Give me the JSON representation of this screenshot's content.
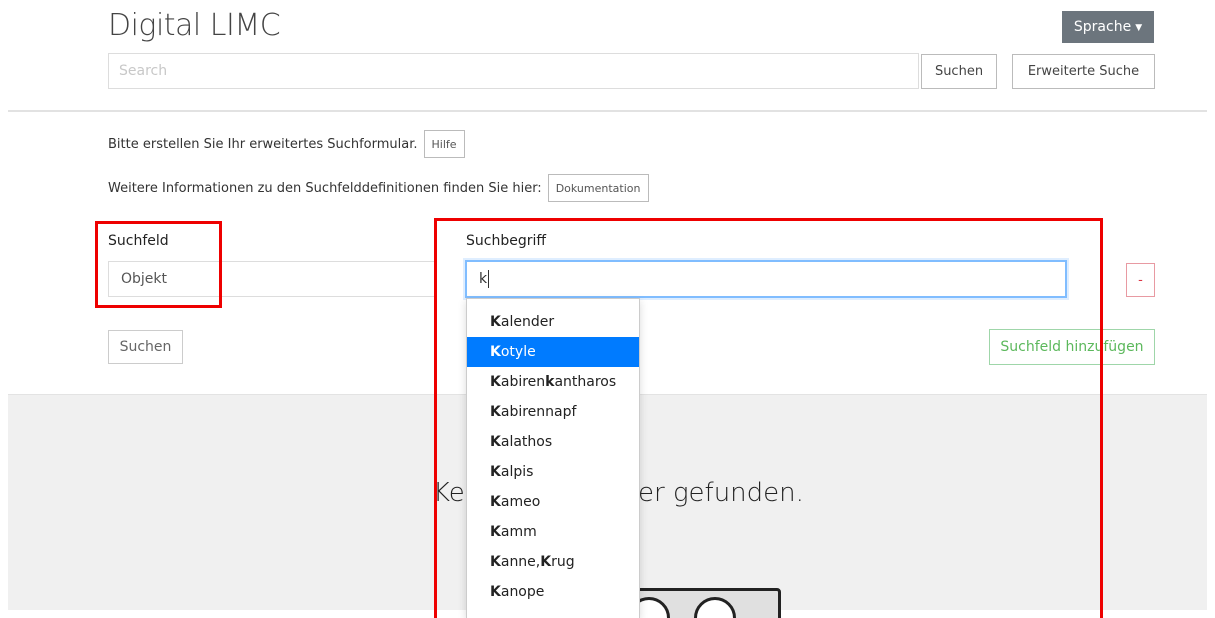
{
  "header": {
    "brand": "Digital LIMC",
    "language_button": "Sprache",
    "search_placeholder": "Search",
    "search_button": "Suchen",
    "advanced_search_button": "Erweiterte Suche"
  },
  "instructions": {
    "create_form_text": "Bitte erstellen Sie Ihr erweitertes Suchformular.",
    "help_button": "Hilfe",
    "docs_text": "Weitere Informationen zu den Suchfelddefinitionen finden Sie hier:",
    "docs_button": "Dokumentation"
  },
  "form": {
    "field_label": "Suchfeld",
    "field_value": "Objekt",
    "term_label": "Suchbegriff",
    "term_value": "k",
    "remove_button": "-",
    "submit_button": "Suchen",
    "add_field_button": "Suchfeld hinzufügen"
  },
  "autocomplete": {
    "items": [
      {
        "bold": "K",
        "rest": "alender"
      },
      {
        "bold": "K",
        "rest": "otyle",
        "active": true
      },
      {
        "bold": "K",
        "mid": "abiren",
        "bold2": "k",
        "rest": "antharos"
      },
      {
        "bold": "K",
        "rest": "abirennapf"
      },
      {
        "bold": "K",
        "rest": "alathos"
      },
      {
        "bold": "K",
        "rest": "alpis"
      },
      {
        "bold": "K",
        "rest": "ameo"
      },
      {
        "bold": "K",
        "rest": "amm"
      },
      {
        "bold": "K",
        "mid": "anne, ",
        "bold2": "K",
        "rest": "rug"
      },
      {
        "bold": "K",
        "rest": "anope"
      }
    ]
  },
  "results": {
    "message_visible_start": "Ke",
    "message_visible_end": "ler gefunden."
  },
  "colors": {
    "highlight": "#ee0000",
    "active_item": "#007bff",
    "language_button": "#6c757d",
    "add_button": "#5cb85c",
    "remove_button": "#dc3545"
  }
}
